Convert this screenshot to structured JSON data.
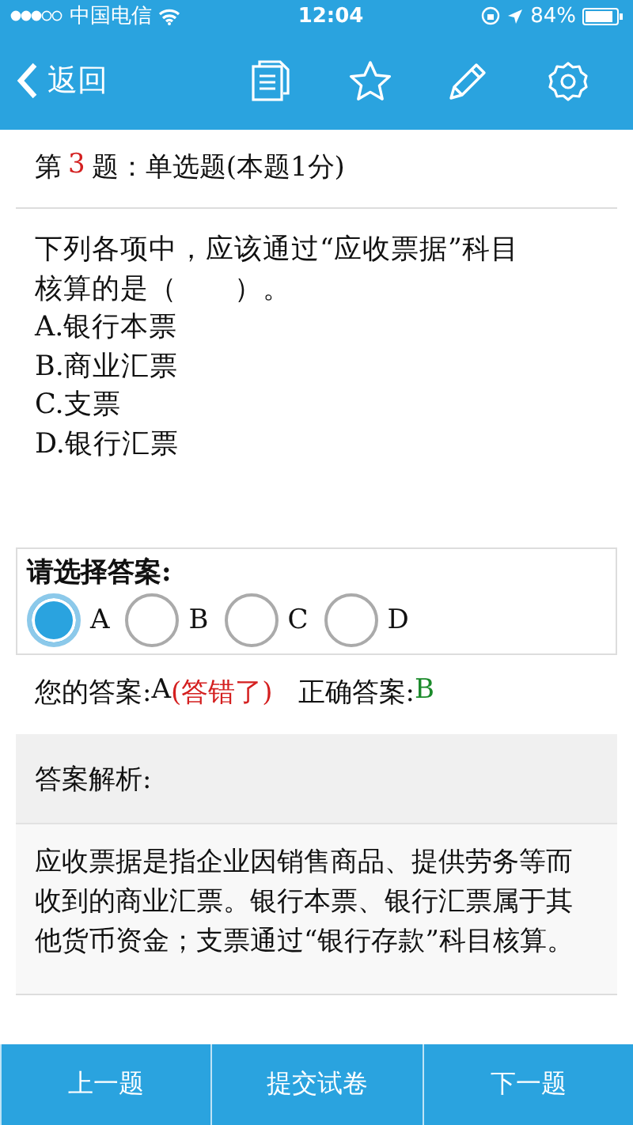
{
  "status_bar": {
    "carrier": "中国电信",
    "time": "12:04",
    "battery": "84%"
  },
  "nav": {
    "back": "返回"
  },
  "question": {
    "prefix": "第",
    "number": "3",
    "suffix": "题：单选题(本题1分)",
    "stem": "下列各项中，应该通过“应收票据”科目核算的是（　　）。",
    "options": [
      "A.银行本票",
      "B.商业汇票",
      "C.支票",
      "D.银行汇票"
    ]
  },
  "answer_box": {
    "prompt": "请选择答案:",
    "choices": [
      {
        "label": "A",
        "selected": true
      },
      {
        "label": "B",
        "selected": false
      },
      {
        "label": "C",
        "selected": false
      },
      {
        "label": "D",
        "selected": false
      }
    ]
  },
  "result": {
    "your_label": "您的答案:",
    "your_value": "A",
    "verdict": "(答错了)",
    "correct": false,
    "correct_label": "正确答案:",
    "correct_value": "B"
  },
  "explanation": {
    "title": "答案解析:",
    "body": "应收票据是指企业因销售商品、提供劳务等而收到的商业汇票。银行本票、银行汇票属于其他货币资金；支票通过“银行存款”科目核算。"
  },
  "bottom_bar": [
    "上一题",
    "提交试卷",
    "下一题"
  ]
}
